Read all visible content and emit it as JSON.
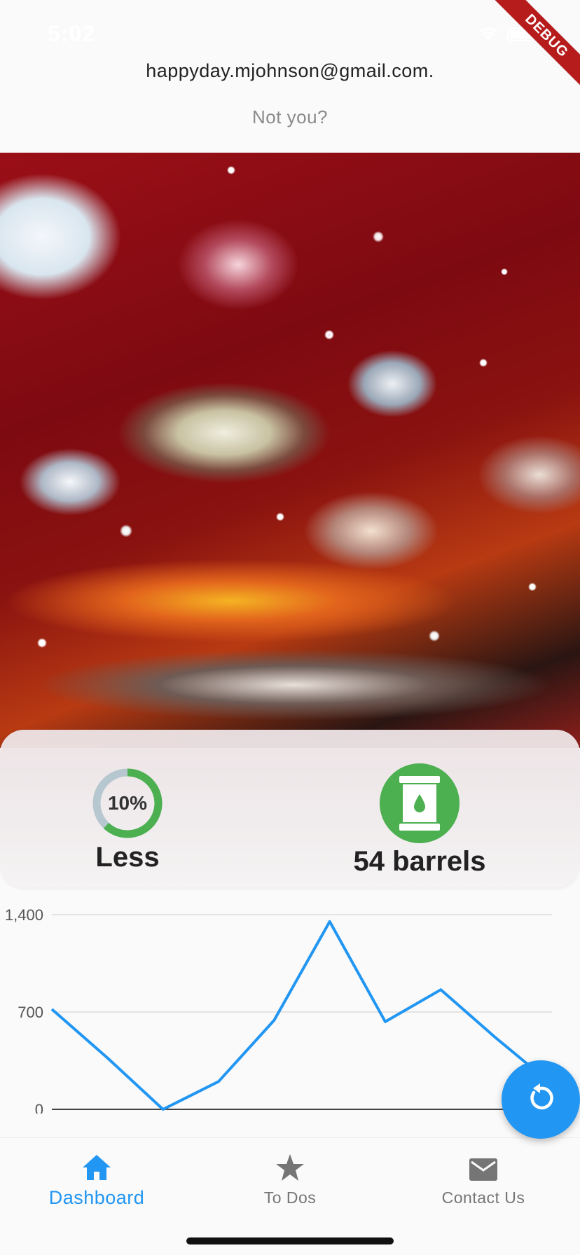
{
  "status_bar": {
    "time": "5:02"
  },
  "debug_banner": "DEBUG",
  "account": {
    "email": "happyday.mjohnson@gmail.com.",
    "not_you": "Not you?"
  },
  "stats": {
    "progress": {
      "percent_label": "10%",
      "fraction": 0.1,
      "label": "Less"
    },
    "barrels": {
      "label": "54 barrels"
    }
  },
  "chart_data": {
    "type": "line",
    "y_ticks": [
      "1,400",
      "700",
      "0"
    ],
    "ylim": [
      0,
      1400
    ],
    "x": [
      0,
      1,
      2,
      3,
      4,
      5,
      6,
      7,
      8,
      9
    ],
    "series": [
      {
        "values": [
          720,
          370,
          0,
          200,
          640,
          1350,
          630,
          860,
          510,
          180
        ]
      }
    ],
    "grid": true,
    "color": "#2196f3"
  },
  "fab": {
    "icon": "refresh-icon"
  },
  "bottom_nav": {
    "items": [
      {
        "label": "Dashboard",
        "icon": "home-icon",
        "active": true
      },
      {
        "label": "To Dos",
        "icon": "star-icon",
        "active": false
      },
      {
        "label": "Contact Us",
        "icon": "mail-icon",
        "active": false
      }
    ]
  },
  "colors": {
    "accent": "#2196f3",
    "success": "#4caf50",
    "inactive": "#757575"
  }
}
